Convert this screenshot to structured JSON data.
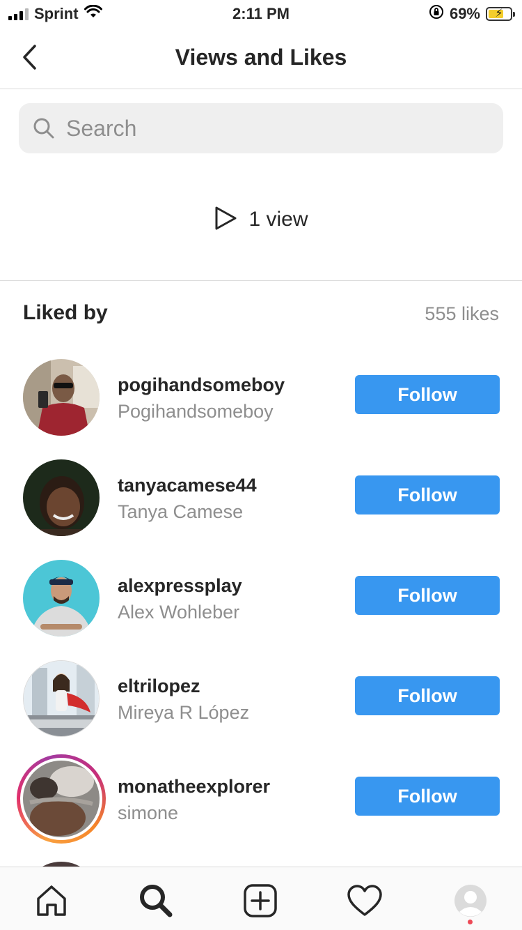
{
  "status_bar": {
    "carrier": "Sprint",
    "time": "2:11 PM",
    "battery_percent": "69%",
    "battery_level": 0.69,
    "signal_icon": "cellular-signal-icon",
    "wifi_icon": "wifi-icon",
    "orientation_lock_icon": "orientation-lock-icon",
    "battery_icon": "battery-charging-icon"
  },
  "header": {
    "title": "Views and Likes",
    "back_icon": "chevron-left-icon"
  },
  "search": {
    "placeholder": "Search",
    "value": "",
    "icon": "search-icon"
  },
  "views": {
    "icon": "play-icon",
    "label": "1 view"
  },
  "liked_by": {
    "title": "Liked by",
    "count_label": "555 likes"
  },
  "users": [
    {
      "username": "pogihandsomeboy",
      "full_name": "Pogihandsomeboy",
      "button": "Follow",
      "has_story": false
    },
    {
      "username": "tanyacamese44",
      "full_name": "Tanya Camese",
      "button": "Follow",
      "has_story": false
    },
    {
      "username": "alexpressplay",
      "full_name": "Alex Wohleber",
      "button": "Follow",
      "has_story": false
    },
    {
      "username": "eltrilopez",
      "full_name": "Mireya R López",
      "button": "Follow",
      "has_story": false
    },
    {
      "username": "monatheexplorer",
      "full_name": "simone",
      "button": "Follow",
      "has_story": true
    }
  ],
  "tab_bar": {
    "items": [
      "home-icon",
      "search-icon",
      "new-post-icon",
      "activity-heart-icon",
      "profile-icon"
    ]
  },
  "colors": {
    "follow_button": "#3897f0",
    "secondary_text": "#8e8e8e",
    "divider": "#dbdbdb",
    "notification_dot": "#ed4956"
  }
}
